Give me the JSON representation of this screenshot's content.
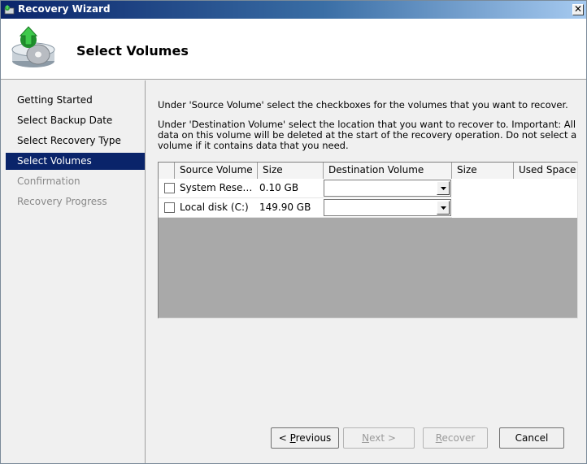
{
  "window": {
    "title": "Recovery Wizard",
    "close_symbol": "✕"
  },
  "header": {
    "title": "Select Volumes"
  },
  "steps": [
    {
      "label": "Getting Started",
      "state": "normal"
    },
    {
      "label": "Select Backup Date",
      "state": "normal"
    },
    {
      "label": "Select Recovery Type",
      "state": "normal"
    },
    {
      "label": "Select Volumes",
      "state": "active"
    },
    {
      "label": "Confirmation",
      "state": "disabled"
    },
    {
      "label": "Recovery Progress",
      "state": "disabled"
    }
  ],
  "instructions": {
    "p1": "Under 'Source Volume' select the checkboxes for the volumes that you want to recover.",
    "p2_line1": "Under 'Destination Volume' select the location that you want to recover to. Important: All",
    "p2_line2": "data on this volume will be deleted at the start of the recovery operation. Do not select a",
    "p2_line3": "volume if it contains data that you need."
  },
  "grid": {
    "columns": [
      "Source Volume",
      "Size",
      "Destination Volume",
      "Size",
      "Used Space"
    ],
    "rows": [
      {
        "checked": false,
        "source": "System Rese…",
        "size": "0.10 GB",
        "destination": "",
        "dest_size": "",
        "used": ""
      },
      {
        "checked": false,
        "source": "Local disk (C:)",
        "size": "149.90 GB",
        "destination": "",
        "dest_size": "",
        "used": ""
      }
    ]
  },
  "buttons": {
    "previous": {
      "prefix": "< ",
      "mnemonic": "P",
      "rest": "revious"
    },
    "next": {
      "mnemonic": "N",
      "rest": "ext >"
    },
    "recover": {
      "mnemonic": "R",
      "rest": "ecover"
    },
    "cancel": "Cancel"
  },
  "colors": {
    "accent": "#0a246a",
    "disabled_text": "#8a8a8a"
  }
}
